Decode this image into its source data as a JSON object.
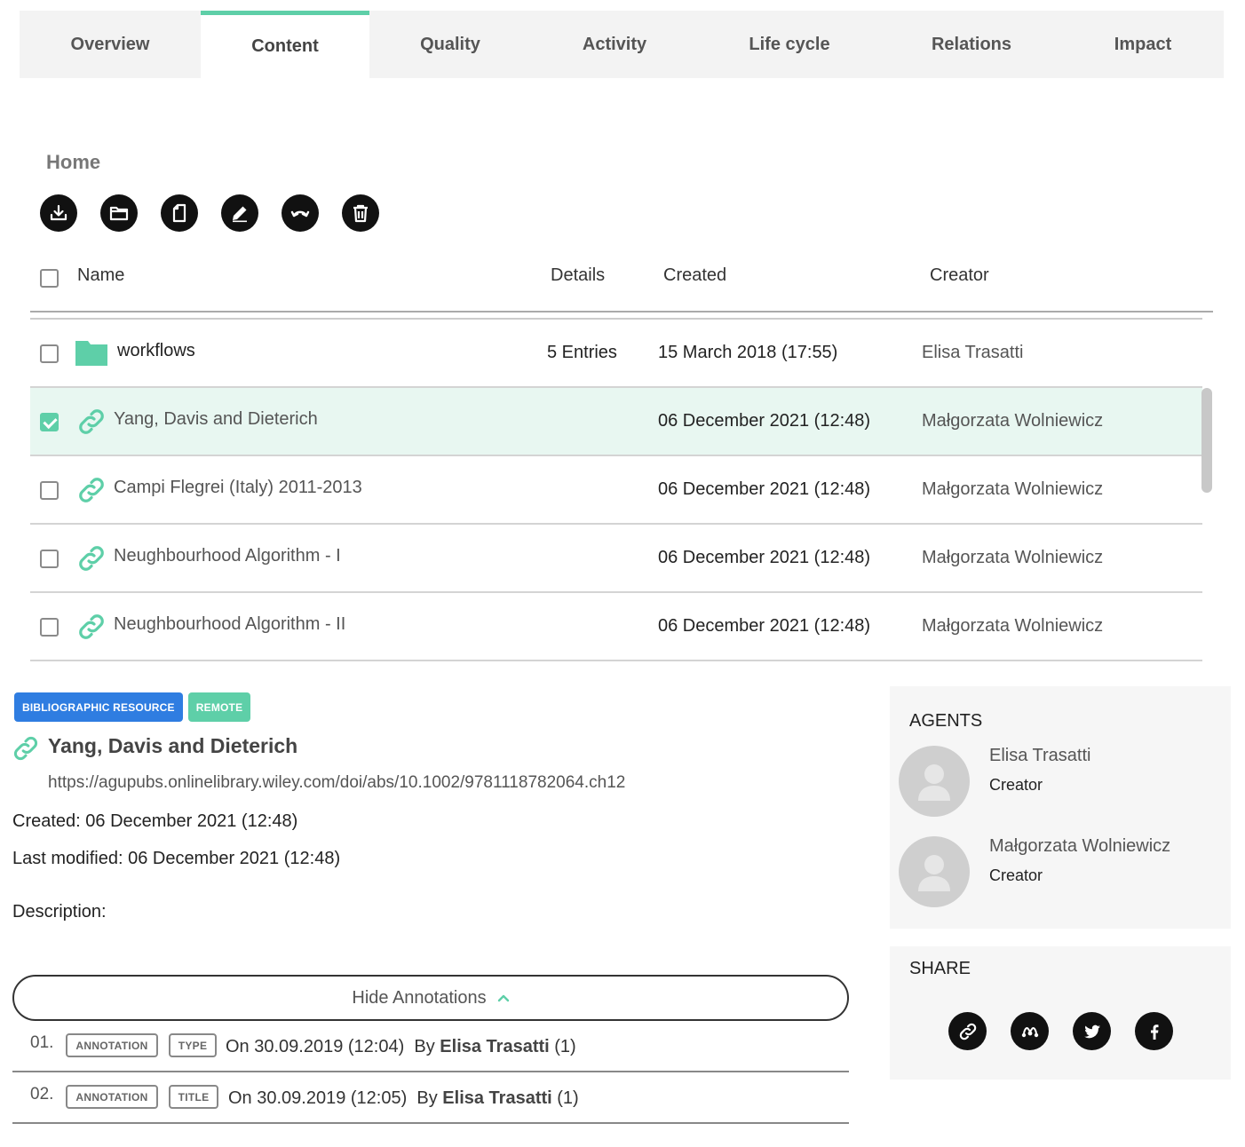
{
  "tabs": [
    {
      "label": "Overview"
    },
    {
      "label": "Content",
      "active": true
    },
    {
      "label": "Quality"
    },
    {
      "label": "Activity"
    },
    {
      "label": "Life cycle"
    },
    {
      "label": "Relations"
    },
    {
      "label": "Impact"
    }
  ],
  "breadcrumb": "Home",
  "toolbar": [
    "download-icon",
    "folder-icon",
    "file-icon",
    "edit-icon",
    "undo-icon",
    "trash-icon"
  ],
  "table": {
    "headers": {
      "name": "Name",
      "details": "Details",
      "created": "Created",
      "creator": "Creator"
    },
    "rows": [
      {
        "type": "folder",
        "name": "workflows",
        "details": "5 Entries",
        "created": "15 March 2018 (17:55)",
        "creator": "Elisa Trasatti",
        "checked": false
      },
      {
        "type": "link",
        "name": "Yang, Davis and Dieterich",
        "details": "",
        "created": "06 December 2021 (12:48)",
        "creator": "Małgorzata Wolniewicz",
        "checked": true
      },
      {
        "type": "link",
        "name": "Campi Flegrei (Italy) 2011-2013",
        "details": "",
        "created": "06 December 2021 (12:48)",
        "creator": "Małgorzata Wolniewicz",
        "checked": false
      },
      {
        "type": "link",
        "name": "Neughbourhood Algorithm - I",
        "details": "",
        "created": "06 December 2021 (12:48)",
        "creator": "Małgorzata Wolniewicz",
        "checked": false
      },
      {
        "type": "link",
        "name": "Neughbourhood Algorithm - II",
        "details": "",
        "created": "06 December 2021 (12:48)",
        "creator": "Małgorzata Wolniewicz",
        "checked": false
      }
    ]
  },
  "detail": {
    "badges": [
      "BIBLIOGRAPHIC RESOURCE",
      "REMOTE"
    ],
    "title": "Yang, Davis and Dieterich",
    "url": "https://agupubs.onlinelibrary.wiley.com/doi/abs/10.1002/9781118782064.ch12",
    "created": "Created: 06 December 2021 (12:48)",
    "modified": "Last modified: 06 December 2021 (12:48)",
    "description_label": "Description:"
  },
  "annotations": {
    "toggle_label": "Hide Annotations",
    "items": [
      {
        "num": "01.",
        "tag1": "ANNOTATION",
        "tag2": "TYPE",
        "on": "On 30.09.2019 (12:04)",
        "by": "By",
        "author": "Elisa Trasatti",
        "count": "(1)"
      },
      {
        "num": "02.",
        "tag1": "ANNOTATION",
        "tag2": "TITLE",
        "on": "On 30.09.2019 (12:05)",
        "by": "By",
        "author": "Elisa Trasatti",
        "count": "(1)"
      }
    ]
  },
  "agents": {
    "title": "AGENTS",
    "items": [
      {
        "name": "Elisa Trasatti",
        "role": "Creator"
      },
      {
        "name": "Małgorzata Wolniewicz",
        "role": "Creator"
      }
    ]
  },
  "share": {
    "title": "SHARE",
    "icons": [
      "link-icon",
      "mendeley-icon",
      "twitter-icon",
      "facebook-icon"
    ]
  },
  "colors": {
    "accent": "#5ecfa8",
    "badge_blue": "#2f7de1",
    "selected_row": "#e8f7f1"
  }
}
